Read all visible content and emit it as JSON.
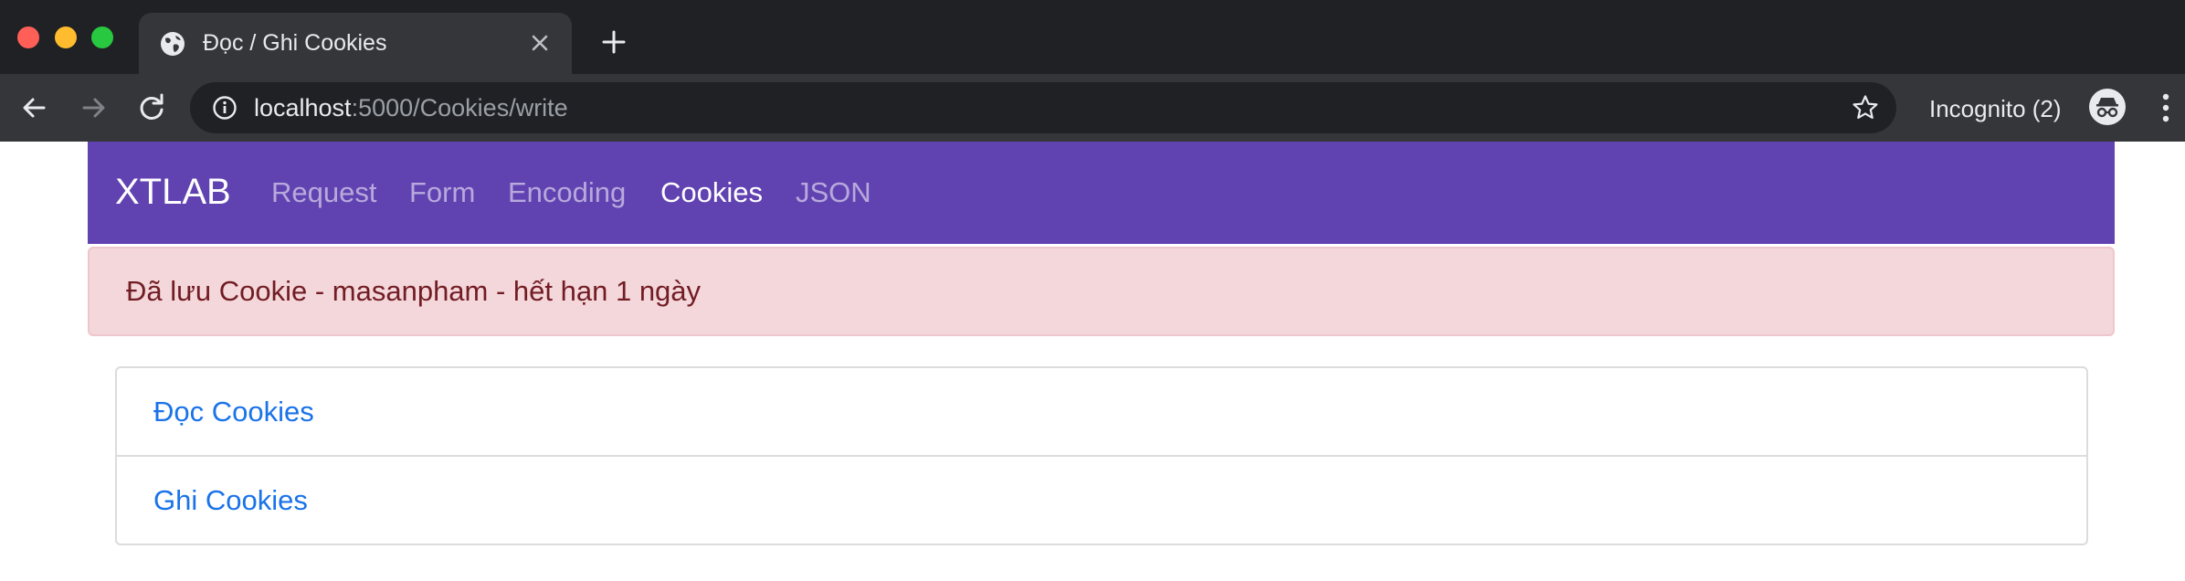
{
  "browser": {
    "tab": {
      "title": "Đọc / Ghi Cookies",
      "favicon": "globe-icon"
    },
    "address": {
      "host": "localhost",
      "path": ":5000/Cookies/write"
    },
    "profile_label": "Incognito (2)"
  },
  "navbar": {
    "brand": "XTLAB",
    "links": [
      {
        "label": "Request",
        "active": false
      },
      {
        "label": "Form",
        "active": false
      },
      {
        "label": "Encoding",
        "active": false
      },
      {
        "label": "Cookies",
        "active": true
      },
      {
        "label": "JSON",
        "active": false
      }
    ],
    "color": "#6142b1"
  },
  "alert": {
    "text": "Đã lưu Cookie - masanpham - hết hạn 1 ngày",
    "color": "#721c24",
    "background": "#f3d7da"
  },
  "list": {
    "items": [
      {
        "label": "Đọc Cookies"
      },
      {
        "label": "Ghi Cookies"
      }
    ],
    "link_color": "#1a73e8"
  }
}
